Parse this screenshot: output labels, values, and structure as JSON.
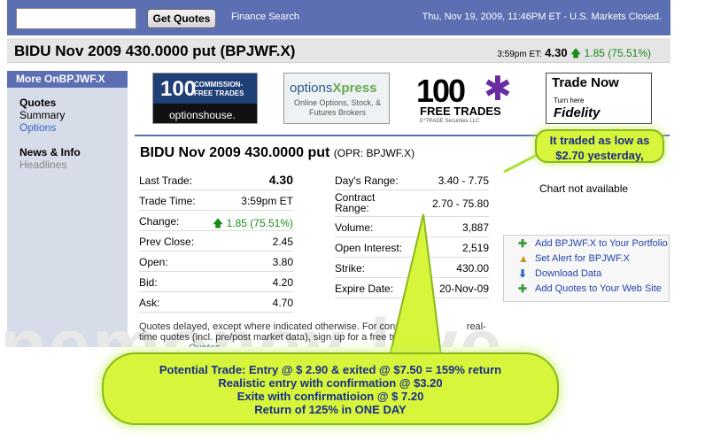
{
  "topbar": {
    "search_value": "",
    "get_quotes_label": "Get Quotes",
    "finance_search": "Finance Search",
    "datetime": "Thu, Nov 19, 2009, 11:46PM ET - U.S. Markets Closed."
  },
  "header": {
    "title": "BIDU Nov 2009 430.0000 put (BPJWF.X)",
    "time": "3:59pm ET:",
    "price": "4.30",
    "change": "1.85 (75.51%)"
  },
  "sidebar": {
    "heading": "More OnBPJWF.X",
    "quotes_heading": "Quotes",
    "summary": "Summary",
    "options": "Options",
    "news_heading": "News & Info",
    "headlines": "Headlines"
  },
  "ads": {
    "optionshouse_number": "100",
    "optionshouse_text": "COMMISSION-FREE TRADES",
    "optionshouse_brand": "optionshouse.",
    "optionsxpress_brand_a": "options",
    "optionsxpress_brand_b": "Xpress",
    "optionsxpress_text": "Online Options, Stock, & Futures Brokers",
    "etrade_number": "100",
    "etrade_text": "FREE TRADES",
    "etrade_small": "E*TRADE Securities LLC",
    "fidelity_title": "Trade Now",
    "fidelity_small": "Turn here",
    "fidelity_brand": "Fidelity"
  },
  "quote": {
    "title": "BIDU Nov 2009 430.0000 put",
    "subtitle": "(OPR: BPJWF.X)",
    "left": [
      {
        "label": "Last Trade:",
        "value": "4.30"
      },
      {
        "label": "Trade Time:",
        "value": "3:59pm ET"
      },
      {
        "label": "Change:",
        "value": "1.85 (75.51%)"
      },
      {
        "label": "Prev Close:",
        "value": "2.45"
      },
      {
        "label": "Open:",
        "value": "3.80"
      },
      {
        "label": "Bid:",
        "value": "4.20"
      },
      {
        "label": "Ask:",
        "value": "4.70"
      }
    ],
    "right": [
      {
        "label": "Day's Range:",
        "value": "3.40 - 7.75"
      },
      {
        "label": "Contract Range:",
        "value": "2.70 - 75.80"
      },
      {
        "label": "Volume:",
        "value": "3,887"
      },
      {
        "label": "Open Interest:",
        "value": "2,519"
      },
      {
        "label": "Strike:",
        "value": "430.00"
      },
      {
        "label": "Expire Date:",
        "value": "20-Nov-09"
      }
    ],
    "note_a": "Quotes delayed, except where indicated otherwise. For cons",
    "note_b": "real-time quotes (incl. pre/post market data), sign up for a free trial of",
    "note_link": "Quotes."
  },
  "chart_placeholder": "Chart not available",
  "links": [
    {
      "icon": "plus-icon",
      "label": "Add BPJWF.X to Your Portfolio"
    },
    {
      "icon": "bell-icon",
      "label": "Set Alert for BPJWF.X"
    },
    {
      "icon": "download-icon",
      "label": "Download Data"
    },
    {
      "icon": "plus-icon",
      "label": "Add Quotes to Your Web Site"
    }
  ],
  "annotations": {
    "callout_small": "It traded as low as $2.70 yesterday,",
    "callout_big": [
      "Potential Trade: Entry @ $ 2.90 & exited @ $7.50 = 159% return",
      "Realistic entry with confirmation @ $3.20",
      "Exite with confirmatioion @ $ 7.20",
      "Return of 125% in ONE DAY"
    ]
  },
  "colors": {
    "brand_blue": "#5b6fb2",
    "up_green": "#1a8a1a",
    "highlight": "#d6f53b",
    "callout_text": "#1a2d8a"
  }
}
